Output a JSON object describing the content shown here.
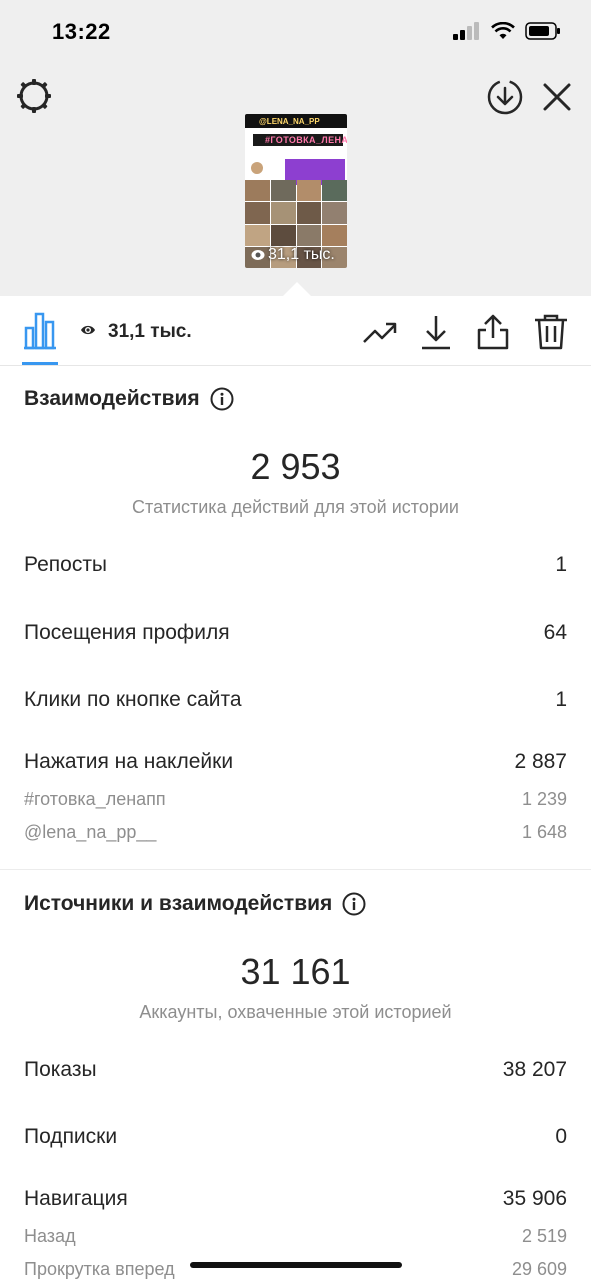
{
  "status_bar": {
    "time": "13:22"
  },
  "preview": {
    "tag_top": "@LENA_NA_PP",
    "tag_hashtag": "#ГОТОВКА_ЛЕНАПП",
    "views_label": "31,1 тыс."
  },
  "toolbar": {
    "views": "31,1 тыс."
  },
  "interactions": {
    "title": "Взаимодействия",
    "total": "2 953",
    "caption": "Статистика действий для этой истории",
    "rows": [
      {
        "label": "Репосты",
        "value": "1"
      },
      {
        "label": "Посещения профиля",
        "value": "64"
      },
      {
        "label": "Клики по кнопке сайта",
        "value": "1"
      },
      {
        "label": "Нажатия на наклейки",
        "value": "2 887"
      }
    ],
    "sticker_rows": [
      {
        "label": "#готовка_ленапп",
        "value": "1 239"
      },
      {
        "label": "@lena_na_pp__",
        "value": "1 648"
      }
    ]
  },
  "discovery": {
    "title": "Источники и взаимодействия",
    "total": "31 161",
    "caption": "Аккаунты, охваченные этой историей",
    "rows": [
      {
        "label": "Показы",
        "value": "38 207"
      },
      {
        "label": "Подписки",
        "value": "0"
      },
      {
        "label": "Навигация",
        "value": "35 906"
      }
    ],
    "nav_rows": [
      {
        "label": "Назад",
        "value": "2 519"
      },
      {
        "label": "Прокрутка вперед",
        "value": "29 609"
      }
    ]
  },
  "colors": {
    "accent": "#3897f0",
    "secondary_text": "#8e8e8e",
    "top_bg": "#efefef"
  }
}
